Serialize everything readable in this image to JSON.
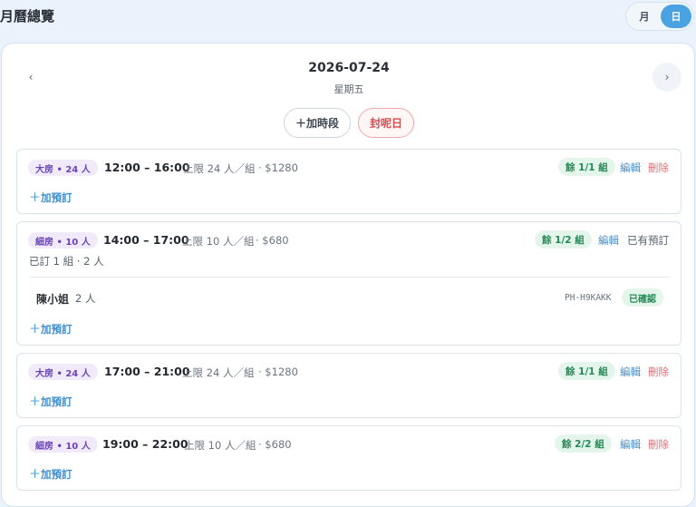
{
  "page": {
    "title": "月曆總覽"
  },
  "view_toggle": {
    "month_label": "月",
    "day_label": "日",
    "active": "日"
  },
  "date_nav": {
    "prev_icon": "‹",
    "next_icon": "›",
    "date": "2026-07-24",
    "weekday": "星期五"
  },
  "actions": {
    "add_slot_label": "＋加時段",
    "close_day_label": "封呢日"
  },
  "common": {
    "add_booking_plus": "＋",
    "add_booking_label": "加預訂",
    "edit_label": "編輯",
    "delete_label": "刪除"
  },
  "slots": [
    {
      "room": "大房 • 24 人",
      "time": "12:00 – 16:00",
      "capacity": "上限 24 人／組",
      "price": "· $1280",
      "remaining": "餘 1/1 組"
    },
    {
      "room": "細房 • 10 人",
      "time": "14:00 – 17:00",
      "capacity": "上限 10 人／組",
      "price": "· $680",
      "remaining": "餘 1/2 組",
      "booked_note": "已有預訂",
      "summary": "已訂 1 組 · 2 人",
      "bookings": [
        {
          "name": "陳小姐",
          "count": "2 人",
          "code": "PH-H9KAKK",
          "status": "已確認"
        }
      ]
    },
    {
      "room": "大房 • 24 人",
      "time": "17:00 – 21:00",
      "capacity": "上限 24 人／組",
      "price": "· $1280",
      "remaining": "餘 1/1 組"
    },
    {
      "room": "細房 • 10 人",
      "time": "19:00 – 22:00",
      "capacity": "上限 10 人／組",
      "price": "· $680",
      "remaining": "餘 2/2 組"
    }
  ],
  "colors": {
    "accent": "#4aa3e0",
    "danger": "#d84b4f",
    "success": "#238a55",
    "badge_purple": "#6a45b5"
  }
}
